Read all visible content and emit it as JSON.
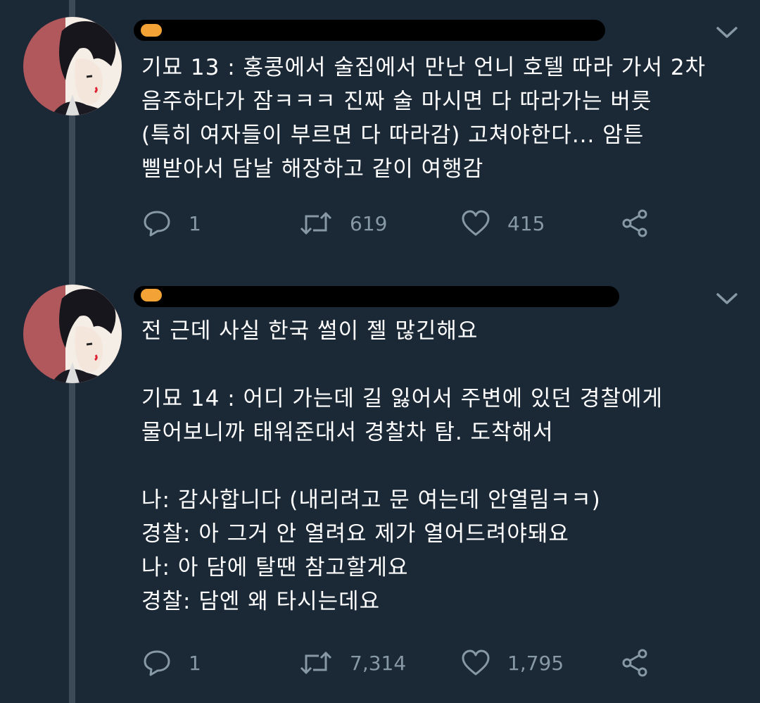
{
  "tweets": [
    {
      "author_visible": "",
      "lines": [
        "기묘 13 : 홍콩에서 술집에서 만난 언니 호텔 따라 가서 2차",
        "음주하다가 잠ㅋㅋㅋ 진짜 술 마시면 다 따라가는 버릇",
        "(특히 여자들이 부르면 다 따라감) 고쳐야한다... 암튼",
        "삘받아서 담날 해장하고 같이 여행감"
      ],
      "reply_count": "1",
      "retweet_count": "619",
      "like_count": "415"
    },
    {
      "author_visible": "",
      "lines": [
        "전 근데 사실 한국 썰이 젤 많긴해요",
        "",
        "기묘 14 : 어디 가는데 길 잃어서 주변에 있던 경찰에게",
        "물어보니까 태워준대서 경찰차 탐. 도착해서",
        "",
        "나: 감사합니다 (내리려고 문 여는데 안열림ㅋㅋ)",
        "경찰: 아 그거 안 열려요 제가 열어드려야돼요",
        "나: 아 담에 탈땐 참고할게요",
        "경찰: 담엔 왜 타시는데요"
      ],
      "reply_count": "1",
      "retweet_count": "7,314",
      "like_count": "1,795"
    }
  ],
  "icons": {
    "reply": "reply-icon",
    "retweet": "retweet-icon",
    "like": "heart-icon",
    "share": "share-icon",
    "more": "chevron-down-icon"
  },
  "colors": {
    "background": "#1b2836",
    "text": "#ffffff",
    "muted": "#8899a6",
    "thread_line": "#3c4a58",
    "redaction": "#000000"
  }
}
